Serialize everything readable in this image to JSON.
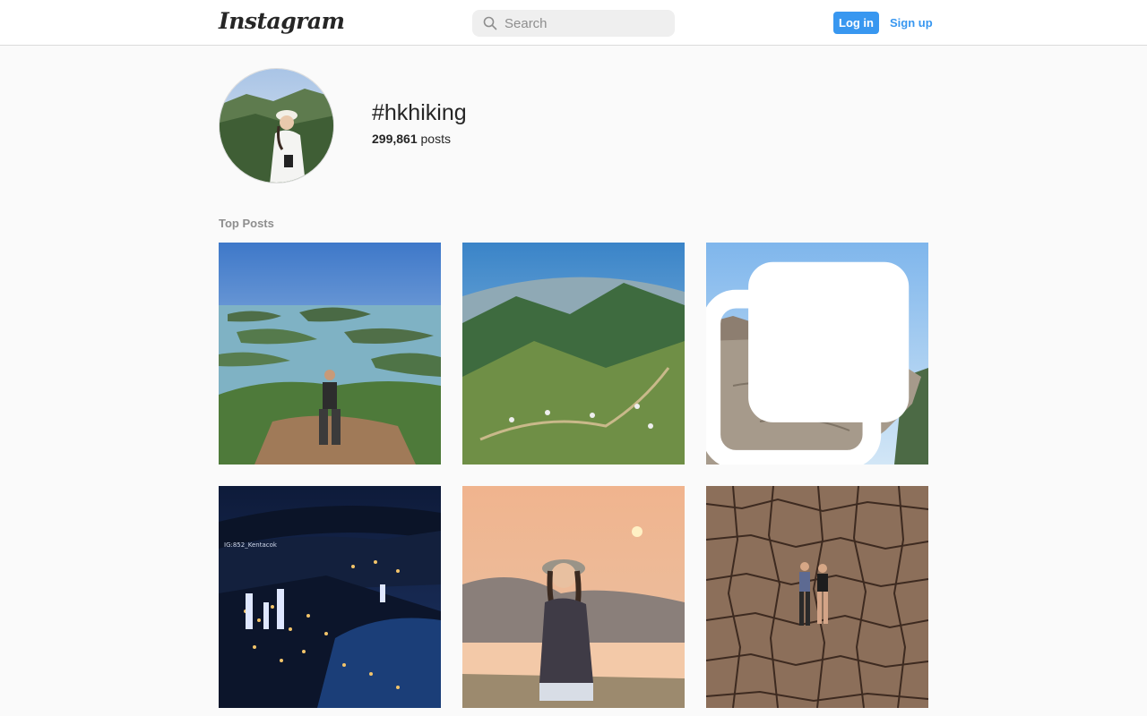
{
  "header": {
    "logo_text": "Instagram",
    "search_placeholder": "Search",
    "login_label": "Log in",
    "signup_label": "Sign up"
  },
  "tag": {
    "name": "#hkhiking",
    "post_count": "299,861",
    "post_count_suffix": "posts"
  },
  "top_posts": {
    "title": "Top Posts",
    "posts": [
      {
        "name": "post-1",
        "multi": false
      },
      {
        "name": "post-2",
        "multi": false
      },
      {
        "name": "post-3",
        "multi": true
      },
      {
        "name": "post-4",
        "multi": false,
        "watermark": "IG:852_Kentacok"
      },
      {
        "name": "post-5",
        "multi": false
      },
      {
        "name": "post-6",
        "multi": false
      }
    ]
  },
  "colors": {
    "accent": "#3897f0",
    "border": "#dbdbdb",
    "muted": "#8e8e8e"
  }
}
